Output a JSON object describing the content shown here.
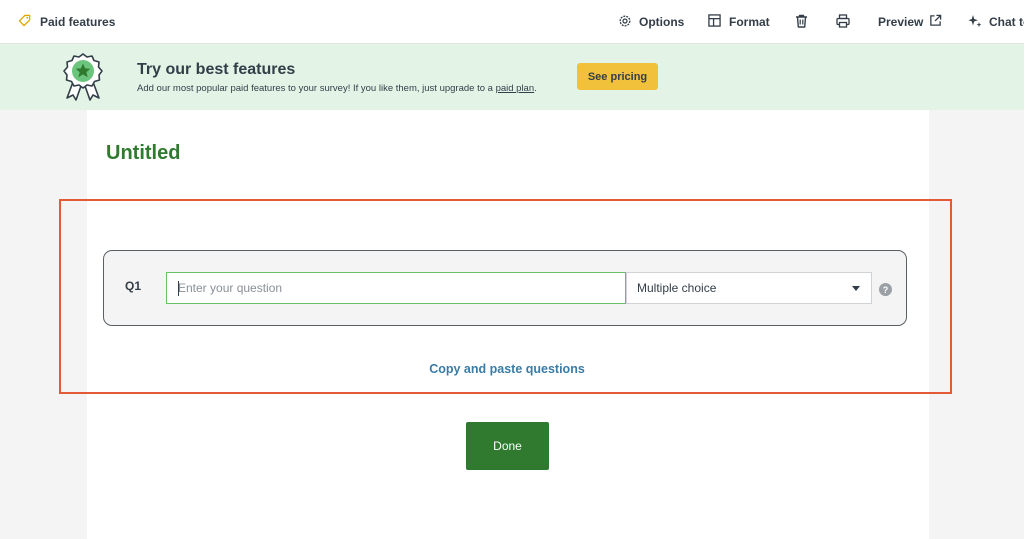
{
  "toolbar": {
    "paid_features": "Paid features",
    "options": "Options",
    "format": "Format",
    "preview": "Preview",
    "chat": "Chat to"
  },
  "banner": {
    "title": "Try our best features",
    "subtitle_prefix": "Add our most popular paid features to your survey! If you like them, just upgrade to a ",
    "subtitle_link": "paid plan",
    "subtitle_suffix": ".",
    "pricing_button": "See pricing"
  },
  "survey": {
    "title": "Untitled"
  },
  "question": {
    "number": "Q1",
    "input_value": "",
    "input_placeholder": "Enter your question",
    "type_selected": "Multiple choice",
    "help": "?"
  },
  "copy_paste_link": "Copy and paste questions",
  "done_button": "Done",
  "colors": {
    "brand_green": "#2f7a2f",
    "banner_bg": "#e3f4e7",
    "pricing_yellow": "#f2c13c",
    "highlight_red": "#e35a38",
    "link_blue": "#3a7ca5"
  }
}
